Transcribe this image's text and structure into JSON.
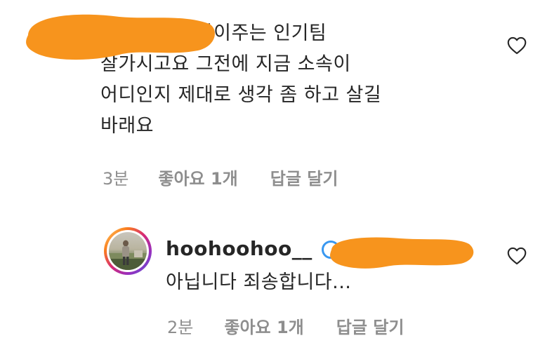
{
  "comment": {
    "text": "몇년뒤에 돈많이주는 인기팀\n잘가시고요 그전에 지금 소속이\n어디인지 제대로 생각 좀 하고 살길\n바래요",
    "time": "3분",
    "likes": "좋아요 1개",
    "reply_action": "답글 달기"
  },
  "reply": {
    "username": "hoohoohoo__",
    "text": "아닙니다 죄송합니다...",
    "time": "2분",
    "likes": "좋아요 1개",
    "reply_action": "답글 달기"
  },
  "icons": {
    "like": "heart-outline-icon",
    "verified": "verified-badge-icon"
  },
  "colors": {
    "text": "#262626",
    "meta": "#8e8e8e",
    "redaction": "#f7941d"
  }
}
